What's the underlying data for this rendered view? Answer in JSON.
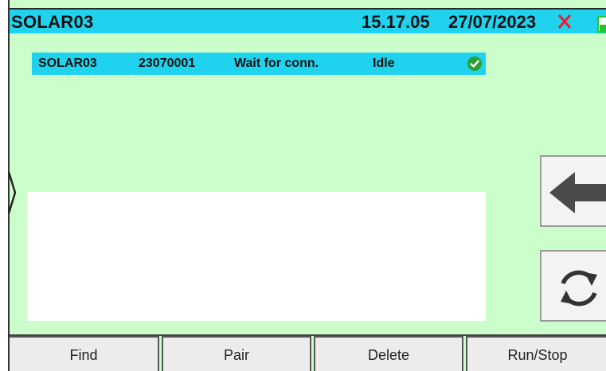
{
  "header": {
    "title": "SOLAR03",
    "time": "15.17.05",
    "date": "27/07/2023",
    "close_icon": "red-x-icon",
    "battery_icon": "battery-icon"
  },
  "device_list": [
    {
      "name": "SOLAR03",
      "serial": "23070001",
      "status": "Wait for conn.",
      "state": "Idle",
      "check_icon": "green-check-icon"
    }
  ],
  "side_buttons": {
    "back_icon": "arrow-left-icon",
    "refresh_icon": "refresh-icon"
  },
  "bottom_bar": {
    "find": "Find",
    "pair": "Pair",
    "delete": "Delete",
    "run_stop": "Run/Stop"
  },
  "colors": {
    "header_bg": "#1fd3ef",
    "screen_bg": "#ccfecc",
    "close_red": "#e8202a",
    "battery_green": "#22c42a",
    "check_green": "#2e9e35"
  }
}
